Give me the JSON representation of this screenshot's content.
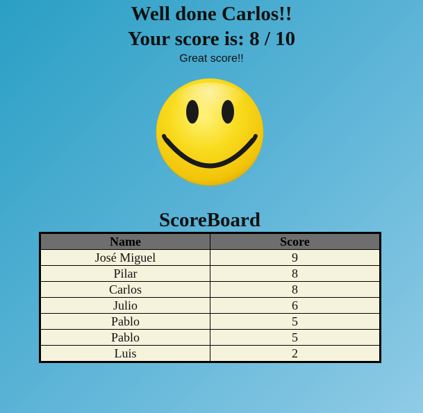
{
  "result": {
    "greeting": "Well done Carlos!!",
    "score_line": "Your score is: 8 / 10",
    "comment": "Great score!!",
    "icon": "smiley-face-icon"
  },
  "scoreboard": {
    "title": "ScoreBoard",
    "columns": [
      "Name",
      "Score"
    ],
    "rows": [
      {
        "name": "José Miguel",
        "score": "9"
      },
      {
        "name": "Pilar",
        "score": "8"
      },
      {
        "name": "Carlos",
        "score": "8"
      },
      {
        "name": "Julio",
        "score": "6"
      },
      {
        "name": "Pablo",
        "score": "5"
      },
      {
        "name": "Pablo",
        "score": "5"
      },
      {
        "name": "Luis",
        "score": "2"
      }
    ]
  },
  "colors": {
    "background_start": "#2a9fc4",
    "background_end": "#8fcbe6",
    "header_row": "#6e6e6e",
    "cell_background": "#f5f3dc",
    "smiley_yellow": "#f7d417"
  }
}
